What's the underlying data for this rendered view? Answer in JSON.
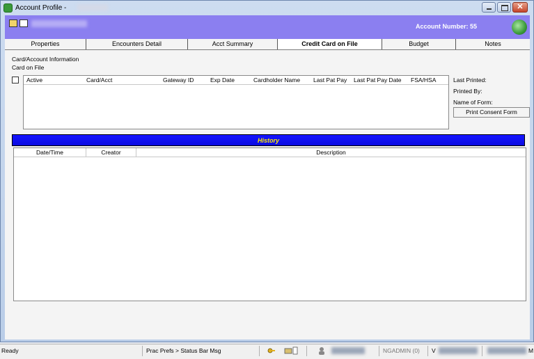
{
  "window": {
    "title": "Account Profile -",
    "controls": {
      "minimize": "–",
      "maximize": "□",
      "close": "✕"
    }
  },
  "header": {
    "account_number_label": "Account Number: 55"
  },
  "tabs": [
    {
      "label": "Properties",
      "active": false
    },
    {
      "label": "Encounters Detail",
      "active": false
    },
    {
      "label": "Acct Summary",
      "active": false
    },
    {
      "label": "Credit Card on File",
      "active": true
    },
    {
      "label": "Budget",
      "active": false
    },
    {
      "label": "Notes",
      "active": false
    }
  ],
  "card_section": {
    "section_label": "Card/Account Information",
    "subsection_label": "Card on File",
    "columns": [
      "Active",
      "Card/Acct",
      "Gateway ID",
      "Exp Date",
      "Cardholder Name",
      "Last Pat Pay",
      "Last Pat Pay Date",
      "FSA/HSA"
    ],
    "rows": [],
    "side": {
      "last_printed": "Last Printed:",
      "printed_by": "Printed By:",
      "name_of_form": "Name of Form:",
      "print_button": "Print Consent Form"
    }
  },
  "history": {
    "title": "History",
    "columns": [
      "Date/Time",
      "Creator",
      "Description"
    ],
    "rows": []
  },
  "status_bar": {
    "ready": "Ready",
    "message": "Prac Prefs > Status Bar Msg",
    "user_fragment": "NGADMIN (0)",
    "version_fragment": "V",
    "end_fragment": "M"
  },
  "colors": {
    "header_purple": "#8b7ff0",
    "history_blue": "#1414ff",
    "history_title": "#ffeb00"
  },
  "icons": [
    "app-icon",
    "folder-open-icon",
    "form-icon",
    "status-globe-icon",
    "key-icon",
    "printer-icon",
    "user-icon"
  ]
}
